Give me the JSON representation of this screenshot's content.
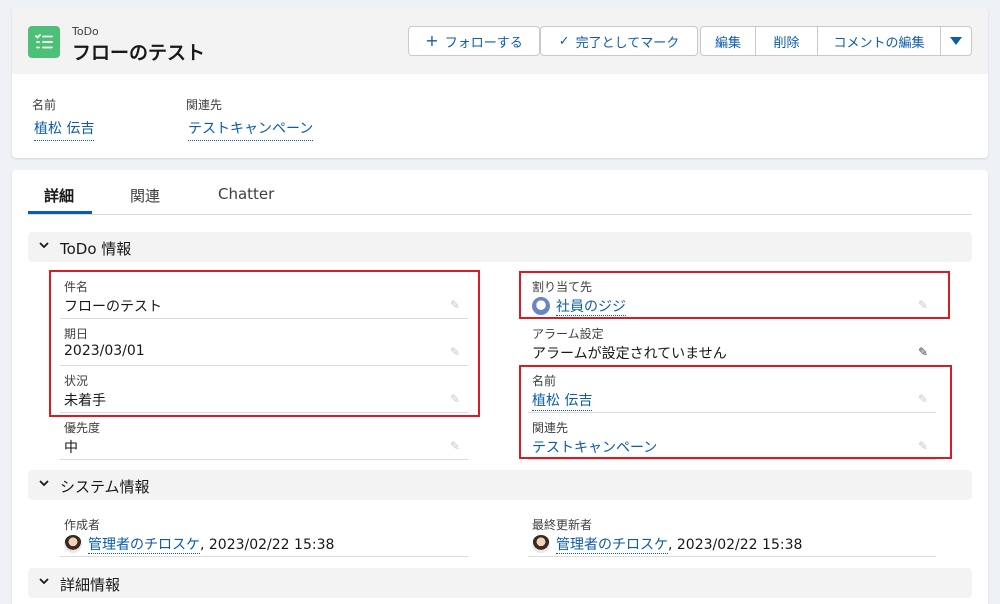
{
  "header": {
    "object_type": "ToDo",
    "title": "フローのテスト",
    "buttons": {
      "follow": "フォローする",
      "complete": "完了としてマーク",
      "edit": "編集",
      "delete": "削除",
      "comment_edit": "コメントの編集"
    },
    "highlights": {
      "name_label": "名前",
      "name_value": "植松 伝吉",
      "related_label": "関連先",
      "related_value": "テストキャンペーン"
    }
  },
  "tabs": {
    "detail": "詳細",
    "related": "関連",
    "chatter": "Chatter"
  },
  "todo_section": {
    "title": "ToDo 情報",
    "subject_label": "件名",
    "subject_value": "フローのテスト",
    "due_label": "期日",
    "due_value": "2023/03/01",
    "status_label": "状況",
    "status_value": "未着手",
    "priority_label": "優先度",
    "priority_value": "中",
    "assigned_label": "割り当て先",
    "assigned_value": "社員のジジ",
    "alarm_label": "アラーム設定",
    "alarm_value": "アラームが設定されていません",
    "name_label": "名前",
    "name_value": "植松 伝吉",
    "related_label": "関連先",
    "related_value": "テストキャンペーン"
  },
  "system_section": {
    "title": "システム情報",
    "created_label": "作成者",
    "created_user": "管理者のチロスケ",
    "created_date": ", 2023/02/22 15:38",
    "modified_label": "最終更新者",
    "modified_user": "管理者のチロスケ",
    "modified_date": ", 2023/02/22 15:38"
  },
  "detail_section": {
    "title": "詳細情報"
  },
  "colors": {
    "brand_link": "#0b5cab",
    "todo_icon": "#4bc076",
    "highlight_box": "#d61c24"
  },
  "icons": [
    "task-list-icon",
    "plus-icon",
    "check-icon",
    "chevron-down-icon",
    "pencil-icon"
  ]
}
